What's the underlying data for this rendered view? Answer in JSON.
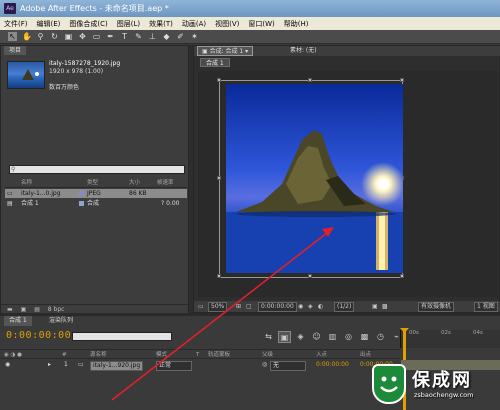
{
  "window": {
    "title": "Adobe After Effects - 未命名项目.aep *",
    "app_icon": "Ae"
  },
  "menu": [
    "文件(F)",
    "编辑(E)",
    "图像合成(C)",
    "图层(L)",
    "效果(T)",
    "动画(A)",
    "视图(V)",
    "窗口(W)",
    "帮助(H)"
  ],
  "tools": [
    "selection-tool",
    "hand-tool",
    "zoom-tool",
    "rotate-tool",
    "camera-tool",
    "pan-behind-tool",
    "rectangle-tool",
    "pen-tool",
    "text-tool",
    "brush-tool",
    "clone-stamp-tool",
    "eraser-tool",
    "roto-brush-tool",
    "puppet-tool"
  ],
  "project": {
    "tab": "项目",
    "selected_name": "italy-1587278_1920.jpg",
    "selected_dims": "1920 x 978 (1.00)",
    "selected_color": "数百万颜色",
    "columns": [
      "名称",
      "类型",
      "大小",
      "帧速率"
    ],
    "items": [
      {
        "name": "italy-1...0.jpg",
        "type": "JPEG",
        "size": "86 KB",
        "fps": "",
        "color": "#8a8ac8"
      },
      {
        "name": "合成 1",
        "type": "合成",
        "size": "",
        "fps": "? 0.00",
        "color": "#8aa6c8"
      }
    ],
    "bit_depth": "8 bpc"
  },
  "composition": {
    "tab": "合成: 合成 1",
    "tab2": "素材: (无)",
    "subtab": "合成 1",
    "zoom": "50%",
    "timecode": "0:00:00:00",
    "resolution": "(1/2)",
    "camera": "有效摄像机",
    "views": "1 视图"
  },
  "timeline": {
    "tab": "合成 1",
    "tab2": "渲染队列",
    "timecode": "0:00:00:00",
    "columns": [
      "#",
      "源名称",
      "模式",
      "T",
      "轨道蒙板",
      "父级",
      "入点",
      "出点"
    ],
    "layer": {
      "index": "1",
      "name": "italy-1...920.jpg",
      "mode": "正常",
      "parent": "无",
      "in": "0:00:00:00",
      "out": "0:00:00:00"
    },
    "ruler_labels": [
      "00s",
      "02s",
      "04s"
    ]
  },
  "watermark": {
    "brand": "保成网",
    "url": "zsbaochengw.com"
  },
  "colors": {
    "timecode": "#e0a000",
    "arrow": "#e0202a",
    "watermark_green": "#1d8a3a"
  }
}
